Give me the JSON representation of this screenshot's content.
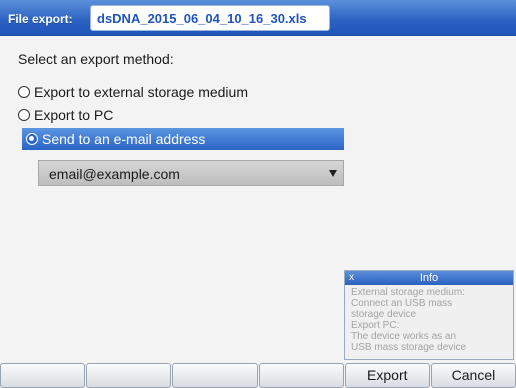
{
  "titlebar": {
    "label": "File export:",
    "filename": "dsDNA_2015_06_04_10_16_30.xls"
  },
  "prompt": "Select an export method:",
  "options": [
    {
      "label": "Export to external storage medium",
      "selected": false
    },
    {
      "label": "Export to PC",
      "selected": false
    },
    {
      "label": "Send to an e-mail address",
      "selected": true
    }
  ],
  "email_select": {
    "value": "email@example.com"
  },
  "info": {
    "close": "x",
    "title": "Info",
    "lines": [
      "External storage medium:",
      "Connect an USB mass",
      "storage device",
      "Export PC:",
      "The device works as an",
      "USB mass storage device"
    ]
  },
  "softkeys": [
    "",
    "",
    "",
    "",
    "Export",
    "Cancel"
  ],
  "colors": {
    "titlebar": "#2a61c2",
    "selection": "#2b64c6",
    "background": "#f3f3f3"
  }
}
